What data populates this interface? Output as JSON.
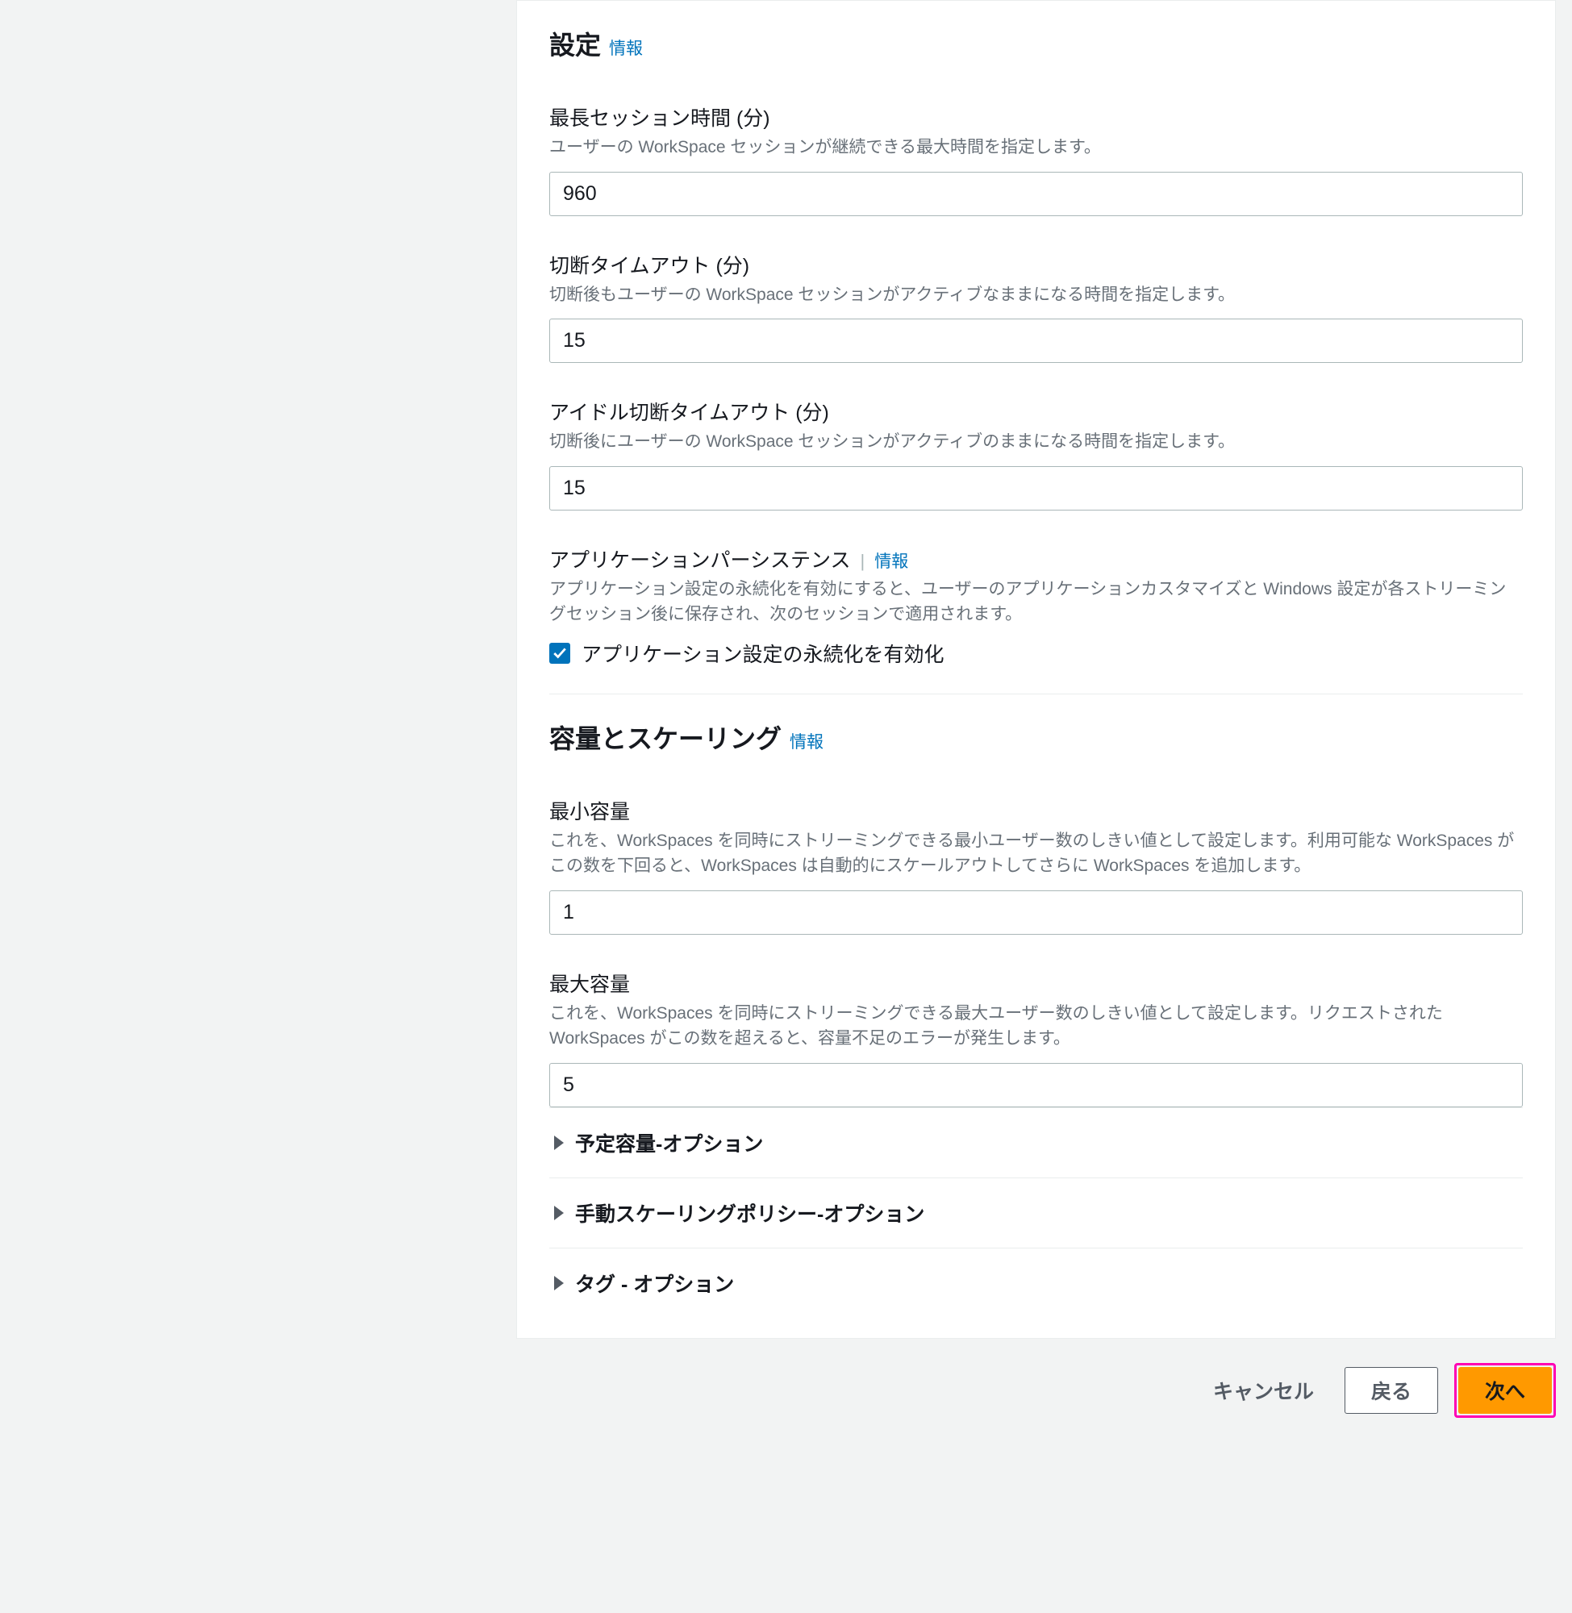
{
  "sections": {
    "settings": {
      "title": "設定",
      "info": "情報"
    },
    "capacity": {
      "title": "容量とスケーリング",
      "info": "情報"
    }
  },
  "fields": {
    "maxSession": {
      "label": "最長セッション時間 (分)",
      "desc": "ユーザーの WorkSpace セッションが継続できる最大時間を指定します。",
      "value": "960"
    },
    "disconnectTimeout": {
      "label": "切断タイムアウト (分)",
      "desc": "切断後もユーザーの WorkSpace セッションがアクティブなままになる時間を指定します。",
      "value": "15"
    },
    "idleDisconnectTimeout": {
      "label": "アイドル切断タイムアウト (分)",
      "desc": "切断後にユーザーの WorkSpace セッションがアクティブのままになる時間を指定します。",
      "value": "15"
    },
    "appPersistence": {
      "label": "アプリケーションパーシステンス",
      "info": "情報",
      "desc": "アプリケーション設定の永続化を有効にすると、ユーザーのアプリケーションカスタマイズと Windows 設定が各ストリーミングセッション後に保存され、次のセッションで適用されます。",
      "checkboxLabel": "アプリケーション設定の永続化を有効化"
    },
    "minCapacity": {
      "label": "最小容量",
      "desc": "これを、WorkSpaces を同時にストリーミングできる最小ユーザー数のしきい値として設定します。利用可能な WorkSpaces がこの数を下回ると、WorkSpaces は自動的にスケールアウトしてさらに WorkSpaces を追加します。",
      "value": "1"
    },
    "maxCapacity": {
      "label": "最大容量",
      "desc": "これを、WorkSpaces を同時にストリーミングできる最大ユーザー数のしきい値として設定します。リクエストされた WorkSpaces がこの数を超えると、容量不足のエラーが発生します。",
      "value": "5"
    }
  },
  "expandables": {
    "scheduledCapacity": "予定容量-オプション",
    "manualScaling": "手動スケーリングポリシー-オプション",
    "tags": "タグ - オプション"
  },
  "buttons": {
    "cancel": "キャンセル",
    "back": "戻る",
    "next": "次へ"
  }
}
